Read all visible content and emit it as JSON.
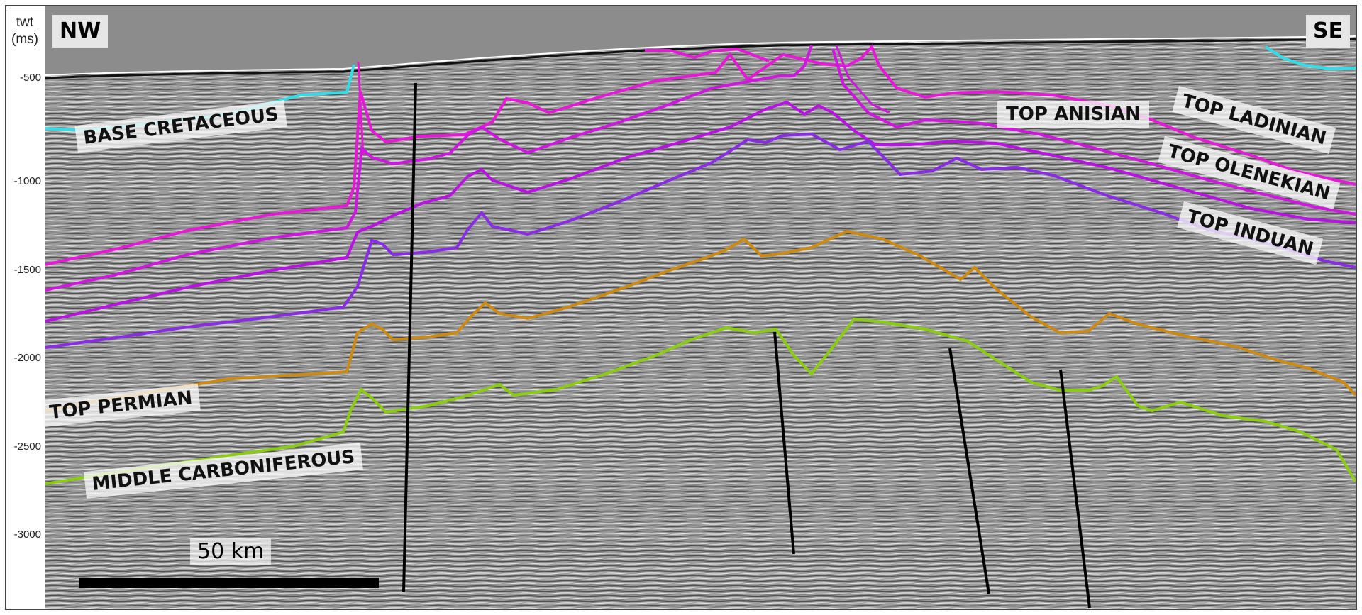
{
  "axis": {
    "title_line1": "twt",
    "title_line2": "(ms)",
    "ticks": [
      "-500",
      "-1000",
      "-1500",
      "-2000",
      "-2500",
      "-3000"
    ]
  },
  "direction": {
    "left": "NW",
    "right": "SE"
  },
  "horizon_labels": {
    "base_cretaceous": "BASE CRETACEOUS",
    "top_anisian": "TOP ANISIAN",
    "top_ladinian": "TOP LADINIAN",
    "top_olenekian": "TOP OLENEKIAN",
    "top_induan": "TOP INDUAN",
    "top_permian": "TOP PERMIAN",
    "middle_carboniferous": "MIDDLE CARBONIFEROUS"
  },
  "scale_bar": {
    "label": "50 km"
  },
  "colors": {
    "water": "#8c8c8c",
    "base_cretaceous": "#33dde8",
    "top_ladinian": "#e818d8",
    "top_anisian": "#d016e0",
    "top_olenekian": "#ba12e4",
    "top_induan": "#8a2be8",
    "top_permian": "#cc8a10",
    "middle_carboniferous": "#8ccc10",
    "fault": "#000000"
  }
}
